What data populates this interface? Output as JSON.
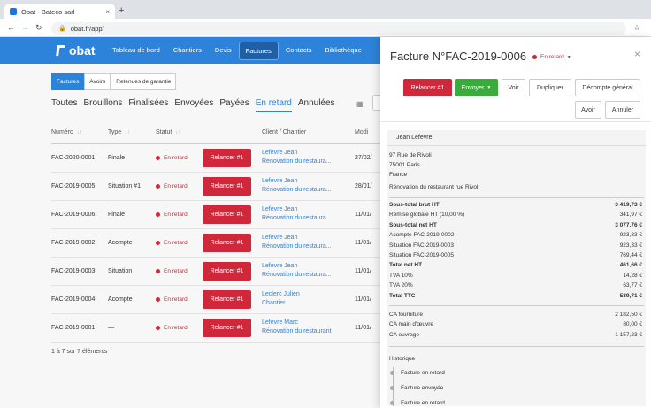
{
  "browser": {
    "tab_title": "Obat - Bateco sarl",
    "tab_close": "×",
    "new_tab": "+",
    "url": "obat.fr/app/"
  },
  "app": {
    "logo": "obat",
    "menu": [
      "Tableau de bord",
      "Chantiers",
      "Devis",
      "Factures",
      "Contacts",
      "Bibliothèque"
    ],
    "active_menu": "Factures"
  },
  "doc_types": [
    "Factures",
    "Avoirs",
    "Retenues de garantie"
  ],
  "filters": [
    "Toutes",
    "Brouillons",
    "Finalisées",
    "Envoyées",
    "Payées",
    "En retard",
    "Annulées"
  ],
  "table": {
    "headers": [
      "Numéro",
      "Type",
      "Statut",
      "",
      "Client / Chantier",
      "Modi"
    ],
    "rows": [
      {
        "numero": "FAC-2020-0001",
        "type": "Finale",
        "statut": "En retard",
        "action": "Relancer #1",
        "client": "Lefevre Jean",
        "chantier": "Rénovation du restaura...",
        "date": "27/02/"
      },
      {
        "numero": "FAC-2019-0005",
        "type": "Situation #1",
        "statut": "En retard",
        "action": "Relancer #1",
        "client": "Lefevre Jean",
        "chantier": "Rénovation du restaura...",
        "date": "28/01/"
      },
      {
        "numero": "FAC-2019-0006",
        "type": "Finale",
        "statut": "En retard",
        "action": "Relancer #1",
        "client": "Lefevre Jean",
        "chantier": "Rénovation du restaura...",
        "date": "11/01/"
      },
      {
        "numero": "FAC-2019-0002",
        "type": "Acompte",
        "statut": "En retard",
        "action": "Relancer #1",
        "client": "Lefevre Jean",
        "chantier": "Rénovation du restaura...",
        "date": "11/01/"
      },
      {
        "numero": "FAC-2019-0003",
        "type": "Situation",
        "statut": "En retard",
        "action": "Relancer #1",
        "client": "Lefevre Jean",
        "chantier": "Rénovation du restaura...",
        "date": "11/01/"
      },
      {
        "numero": "FAC-2019-0004",
        "type": "Acompte",
        "statut": "En retard",
        "action": "Relancer #1",
        "client": "Leclerc Julien",
        "chantier": "Chantier",
        "date": "11/01/"
      },
      {
        "numero": "FAC-2019-0001",
        "type": "—",
        "statut": "En retard",
        "action": "Relancer #1",
        "client": "Lefevre Marc",
        "chantier": "Rénovation du restaurant",
        "date": "11/01/"
      }
    ],
    "pagination": "1 à 7 sur 7 éléments"
  },
  "panel": {
    "title": "Facture N°FAC-2019-0006",
    "status": "En retard",
    "close": "×",
    "buttons": {
      "relancer": "Relancer #1",
      "envoyer": "Envoyer",
      "voir": "Voir",
      "dupliquer": "Dupliquer",
      "decompte": "Décompte général",
      "avoir": "Avoir",
      "annuler": "Annuler"
    },
    "client_name": "Jean Lefevre",
    "address": [
      "97 Rue de Rivoli",
      "75001 Paris",
      "France"
    ],
    "project": "Rénovation du restaurant rue Rivoli",
    "totals": [
      {
        "label": "Sous-total brut HT",
        "value": "3 419,73 €",
        "bold": true
      },
      {
        "label": "Remise globale HT (10,00 %)",
        "value": "341,97 €",
        "bold": false
      },
      {
        "label": "Sous-total net HT",
        "value": "3 077,76 €",
        "bold": true
      },
      {
        "label": "Acompte FAC-2019-0002",
        "value": "923,33 €",
        "bold": false
      },
      {
        "label": "Situation FAC-2019-0003",
        "value": "923,33 €",
        "bold": false
      },
      {
        "label": "Situation FAC-2019-0005",
        "value": "769,44 €",
        "bold": false
      },
      {
        "label": "Total net HT",
        "value": "461,66 €",
        "bold": true
      },
      {
        "label": "TVA 10%",
        "value": "14,28 €",
        "bold": false
      },
      {
        "label": "TVA 20%",
        "value": "63,77 €",
        "bold": false
      },
      {
        "label": "Total TTC",
        "value": "539,71 €",
        "bold": true
      }
    ],
    "ca": [
      {
        "label": "CA fourniture",
        "value": "2 182,50 €"
      },
      {
        "label": "CA main d'œuvre",
        "value": "80,00 €"
      },
      {
        "label": "CA ouvrage",
        "value": "1 157,23 €"
      }
    ],
    "history_title": "Historique",
    "history": [
      "Facture en retard",
      "Facture envoyée",
      "Facture en retard"
    ]
  },
  "colors": {
    "brand_blue": "#2d83d9",
    "danger_red": "#d0283a",
    "success_green": "#3aac3c"
  }
}
